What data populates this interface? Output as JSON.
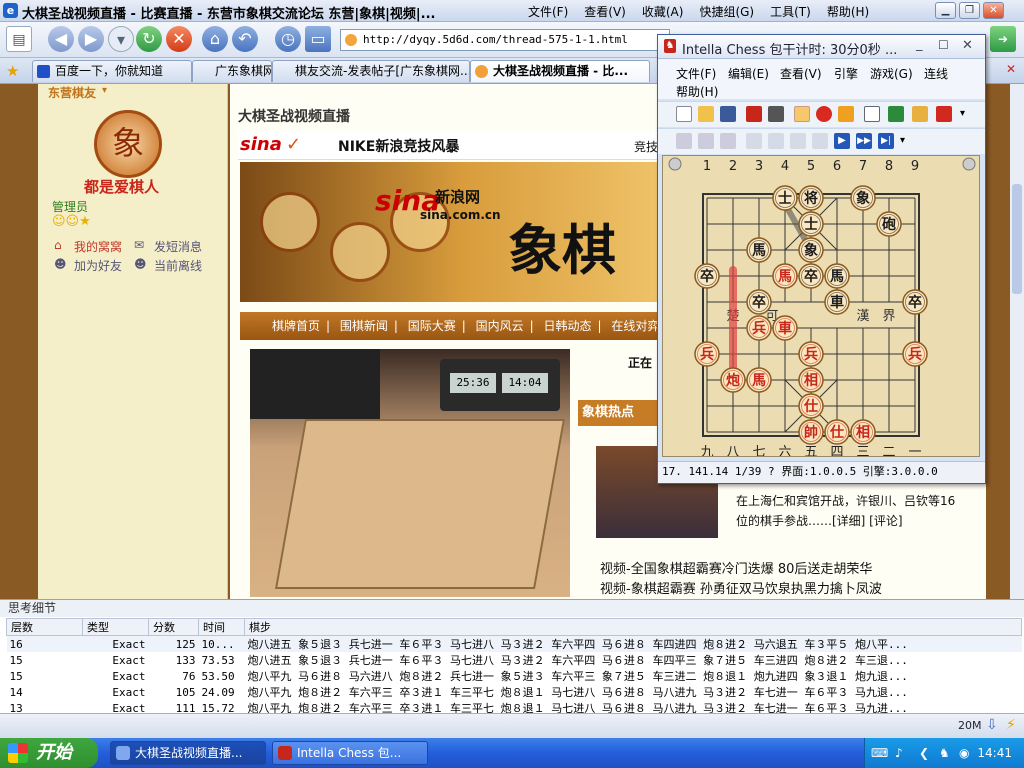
{
  "ie": {
    "title": "大棋圣战视频直播 - 比赛直播 - 东营市象棋交流论坛 东营|象棋|视频|...",
    "menu": [
      "文件(F)",
      "查看(V)",
      "收藏(A)",
      "快捷组(G)",
      "工具(T)",
      "帮助(H)"
    ],
    "address": "http://dyqy.5d6d.com/thread-575-1-1.html",
    "tabs": [
      {
        "label": "百度一下，你就知道",
        "icon_color": "#2050c8"
      },
      {
        "label": "广东象棋网",
        "icon_color": "#d24a1a"
      },
      {
        "label": "棋友交流-发表帖子[广东象棋网...",
        "icon_color": "#d24a1a"
      },
      {
        "label": "大棋圣战视频直播 - 比...",
        "icon_color": "#f2a03a"
      }
    ],
    "status_zoom": "20M"
  },
  "page": {
    "sidebar_heading": "东营棋友",
    "seal_char": "象",
    "username": "都是爱棋人",
    "role": "管理员",
    "links": [
      "我的窝窝",
      "发短消息",
      "加为好友",
      "当前离线"
    ],
    "post_title": "大棋圣战视频直播",
    "sina_logo": "sina",
    "nike_text": "NIKE新浪竞技风暴",
    "banner_site": "新浪网",
    "banner_domain": "sina.com.cn",
    "banner_title": "象棋",
    "top_right": "竞技",
    "nav": [
      "棋牌首页",
      "围棋新闻",
      "国际大赛",
      "国内风云",
      "日韩动态",
      "在线对弈"
    ],
    "live_label": "正在",
    "hot_title": "象棋热点",
    "news_text_a": "在上海仁和宾馆开战，许银川、吕钦等16",
    "news_text_b": "位的棋手参战……[详细] [评论]",
    "news_links": [
      "视频-全国象棋超霸赛冷门迭爆  80后送走胡荣华",
      "视频-象棋超霸赛  孙勇征双马饮泉执黑力擒卜凤波"
    ],
    "clock_left": "25:36",
    "clock_right": "14:04"
  },
  "chess": {
    "title": "Intella Chess 包干计时: 30分0秒 ...",
    "menu_row1": [
      "文件(F)",
      "编辑(E)",
      "查看(V)",
      "引擎",
      "游戏(G)",
      "连线"
    ],
    "menu_row2": [
      "帮助(H)"
    ],
    "top_numbers": [
      "1",
      "2",
      "3",
      "4",
      "5",
      "6",
      "7",
      "8",
      "9"
    ],
    "bottom_numbers": [
      "九",
      "八",
      "七",
      "六",
      "五",
      "四",
      "三",
      "二",
      "一"
    ],
    "river_left": "楚",
    "river_right": "界",
    "river_mid_left": "可",
    "river_mid_right": "漢",
    "status": "17. 141.14 1/39 ? 界面:1.0.0.5 引擎:3.0.0.0",
    "pieces": [
      {
        "char": "士",
        "side": "black",
        "file": 4,
        "rank": 0
      },
      {
        "char": "将",
        "side": "black",
        "file": 5,
        "rank": 0
      },
      {
        "char": "象",
        "side": "black",
        "file": 7,
        "rank": 0
      },
      {
        "char": "士",
        "side": "black",
        "file": 5,
        "rank": 1
      },
      {
        "char": "砲",
        "side": "black",
        "file": 8,
        "rank": 1
      },
      {
        "char": "馬",
        "side": "black",
        "file": 3,
        "rank": 2
      },
      {
        "char": "象",
        "side": "black",
        "file": 5,
        "rank": 2
      },
      {
        "char": "卒",
        "side": "black",
        "file": 1,
        "rank": 3
      },
      {
        "char": "馬",
        "side": "red",
        "file": 4,
        "rank": 3
      },
      {
        "char": "卒",
        "side": "black",
        "file": 5,
        "rank": 3
      },
      {
        "char": "馬",
        "side": "black",
        "file": 6,
        "rank": 3
      },
      {
        "char": "車",
        "side": "black",
        "file": 6,
        "rank": 4
      },
      {
        "char": "卒",
        "side": "black",
        "file": 3,
        "rank": 4
      },
      {
        "char": "卒",
        "side": "black",
        "file": 9,
        "rank": 4
      },
      {
        "char": "兵",
        "side": "red",
        "file": 3,
        "rank": 5
      },
      {
        "char": "車",
        "side": "red",
        "file": 4,
        "rank": 5
      },
      {
        "char": "兵",
        "side": "red",
        "file": 1,
        "rank": 6
      },
      {
        "char": "兵",
        "side": "red",
        "file": 5,
        "rank": 6
      },
      {
        "char": "兵",
        "side": "red",
        "file": 9,
        "rank": 6
      },
      {
        "char": "炮",
        "side": "red",
        "file": 2,
        "rank": 7
      },
      {
        "char": "馬",
        "side": "red",
        "file": 3,
        "rank": 7
      },
      {
        "char": "相",
        "side": "red",
        "file": 5,
        "rank": 7
      },
      {
        "char": "仕",
        "side": "red",
        "file": 5,
        "rank": 8
      },
      {
        "char": "帥",
        "side": "red",
        "file": 5,
        "rank": 9
      },
      {
        "char": "仕",
        "side": "red",
        "file": 6,
        "rank": 9
      },
      {
        "char": "相",
        "side": "red",
        "file": 7,
        "rank": 9
      }
    ]
  },
  "analysis": {
    "title": "思考细节",
    "columns": [
      "层数",
      "类型",
      "分数",
      "时间",
      "棋步"
    ],
    "rows": [
      {
        "depth": "16",
        "type": "Exact",
        "score": "125",
        "time": "10...",
        "moves": "炮八进五 象５退３ 兵七进一 车６平３ 马七进八 马３进２ 车六平四 马６进８ 车四进四 炮８进２ 马六退五 车３平５ 炮八平..."
      },
      {
        "depth": "15",
        "type": "Exact",
        "score": "133",
        "time": "73.53",
        "moves": "炮八进五 象５退３ 兵七进一 车６平３ 马七进八 马３进２ 车六平四 马６进８ 车四平三 象７进５ 车三进四 炮８进２ 车三退..."
      },
      {
        "depth": "15",
        "type": "Exact",
        "score": "76",
        "time": "53.50",
        "moves": "炮八平九 马６进８ 马六进八 炮８进２ 兵七进一 象５进３ 车六平三 象７进５ 车三进二 炮８退１ 炮九进四 象３退１ 炮九退..."
      },
      {
        "depth": "14",
        "type": "Exact",
        "score": "105",
        "time": "24.09",
        "moves": "炮八平九 炮８进２ 车六平三 卒３进１ 车三平七 炮８退１ 马七进八 马６进８ 马八进九 马３进２ 车七进一 车６平３ 马九退..."
      },
      {
        "depth": "13",
        "type": "Exact",
        "score": "111",
        "time": "15.72",
        "moves": "炮八平九 炮８进２ 车六平三 卒３进１ 车三平七 炮８退１ 马七进八 马６进８ 马八进九 马３进２ 车七进一 车６平３ 马九进..."
      }
    ]
  },
  "taskbar": {
    "start": "开始",
    "tasks": [
      "大棋圣战视频直播...",
      "Intella Chess 包..."
    ],
    "time": "14:41"
  },
  "colors": {
    "red_piece": "#c8261b",
    "black_piece": "#1d1d1d",
    "piece_face": "#fbe7bf",
    "board": "#ecdcb2"
  }
}
